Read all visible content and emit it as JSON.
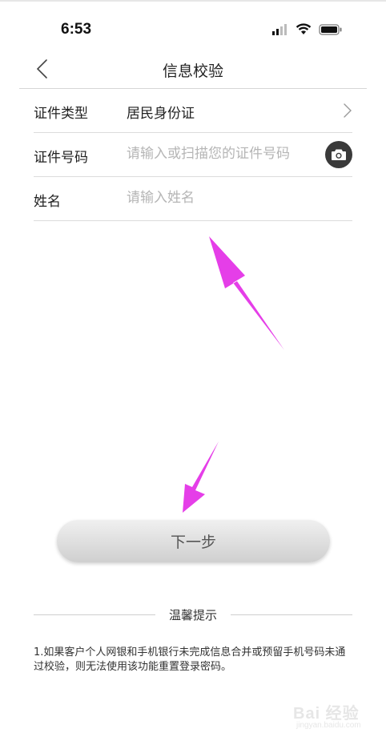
{
  "status_bar": {
    "time": "6:53",
    "icons": [
      "cellular-signal-icon",
      "wifi-icon",
      "battery-icon"
    ]
  },
  "nav": {
    "title": "信息校验",
    "back_icon": "chevron-left-icon"
  },
  "form": {
    "id_type": {
      "label": "证件类型",
      "value": "居民身份证",
      "icon": "chevron-right-icon"
    },
    "id_number": {
      "label": "证件号码",
      "placeholder": "请输入或扫描您的证件号码",
      "icon": "camera-icon"
    },
    "name": {
      "label": "姓名",
      "placeholder": "请输入姓名"
    }
  },
  "next_button": {
    "label": "下一步"
  },
  "tips": {
    "title": "温馨提示",
    "text": "1.如果客户个人网银和手机银行未完成信息合并或预留手机号码未通过校验，则无法使用该功能重置登录密码。"
  },
  "annotations": {
    "arrow_color": "#e53ee8"
  },
  "watermark": {
    "text": "Bai 经验",
    "sub": "jingyan.baidu.com"
  },
  "colors": {
    "divider": "#dcdcdc",
    "placeholder": "#b5b5b5",
    "camera_button": "#3a3a3a"
  }
}
